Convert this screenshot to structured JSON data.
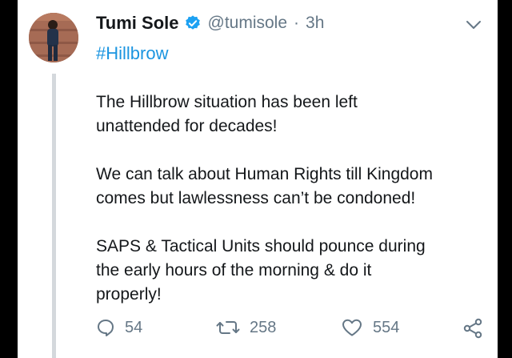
{
  "tweet": {
    "name": "Tumi Sole",
    "handle": "@tumisole",
    "separator": "·",
    "time": "3h",
    "hashtag": "#Hillbrow",
    "paragraphs": [
      "The Hillbrow situation has been left\nunattended for decades!",
      "We can talk about Human Rights till Kingdom\ncomes but lawlessness can’t be condoned!",
      "SAPS & Tactical Units should pounce during\nthe early hours of the morning  & do it\nproperly!"
    ],
    "stats": {
      "replies": "54",
      "retweets": "258",
      "likes": "554"
    }
  },
  "icons": {
    "verified": "verified-badge-icon",
    "caret": "chevron-down-icon",
    "reply": "reply-icon",
    "retweet": "retweet-icon",
    "like": "heart-icon",
    "share": "share-icon"
  },
  "colors": {
    "text": "#14171a",
    "muted": "#657786",
    "link": "#1b95e0",
    "verified": "#1da1f2",
    "thread_line": "#d4d8dc"
  }
}
